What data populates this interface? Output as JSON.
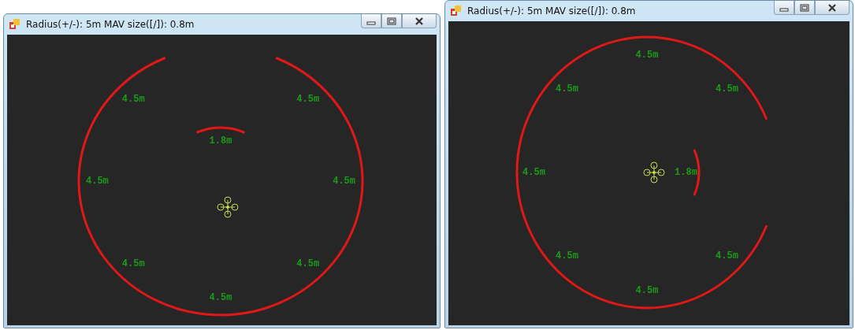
{
  "windows": [
    {
      "title": "Radius(+/-): 5m MAV size([/]): 0.8m",
      "labels": [
        {
          "text": "1.8m",
          "kind": "obstacle"
        },
        {
          "text": "4.5m",
          "kind": "boundary"
        },
        {
          "text": "4.5m",
          "kind": "boundary"
        },
        {
          "text": "4.5m",
          "kind": "boundary"
        },
        {
          "text": "4.5m",
          "kind": "boundary"
        },
        {
          "text": "4.5m",
          "kind": "boundary"
        },
        {
          "text": "4.5m",
          "kind": "boundary"
        },
        {
          "text": "4.5m",
          "kind": "boundary"
        }
      ]
    },
    {
      "title": "Radius(+/-): 5m MAV size([/]): 0.8m",
      "labels": [
        {
          "text": "4.5m",
          "kind": "boundary"
        },
        {
          "text": "4.5m",
          "kind": "boundary"
        },
        {
          "text": "1.8m",
          "kind": "obstacle"
        },
        {
          "text": "4.5m",
          "kind": "boundary"
        },
        {
          "text": "4.5m",
          "kind": "boundary"
        },
        {
          "text": "4.5m",
          "kind": "boundary"
        },
        {
          "text": "4.5m",
          "kind": "boundary"
        },
        {
          "text": "4.5m",
          "kind": "boundary"
        }
      ]
    }
  ]
}
